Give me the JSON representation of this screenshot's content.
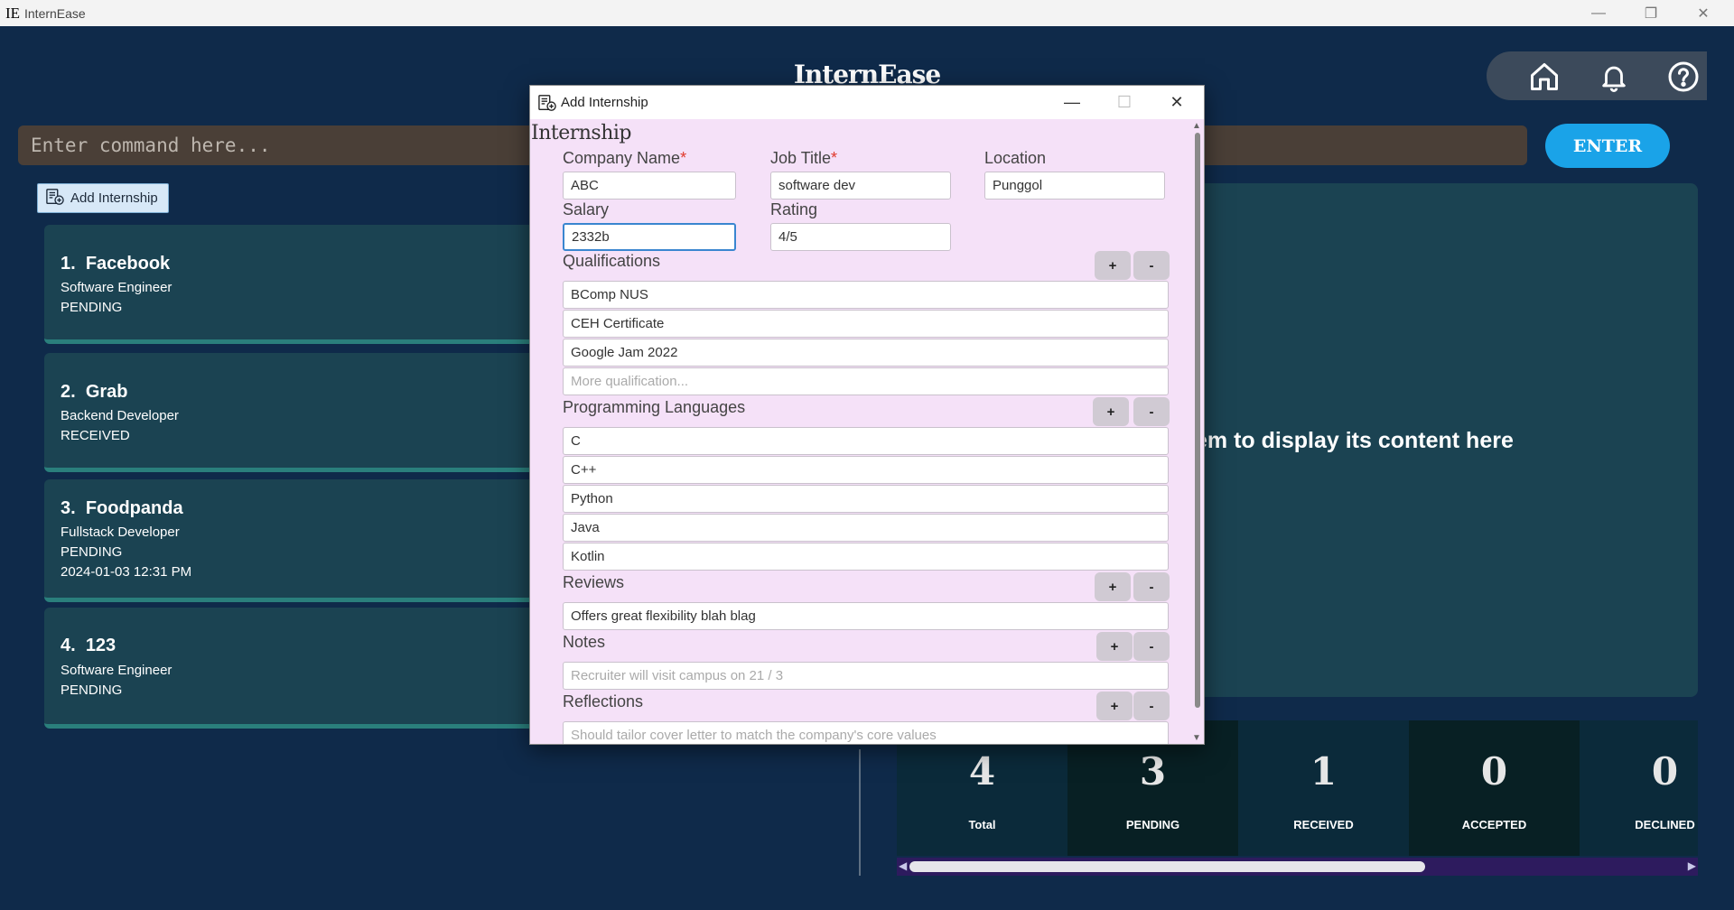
{
  "window": {
    "logo": "IE",
    "title": "InternEase",
    "minimize": "—",
    "maximize": "❐",
    "close": "✕"
  },
  "header": {
    "title": "InternEase"
  },
  "command": {
    "placeholder": "Enter command here...",
    "enter_label": "ENTER"
  },
  "add_button": {
    "label": "Add Internship"
  },
  "internships": [
    {
      "index": "1.",
      "company": "Facebook",
      "role": "Software Engineer",
      "status": "PENDING",
      "date": ""
    },
    {
      "index": "2.",
      "company": "Grab",
      "role": "Backend Developer",
      "status": "RECEIVED",
      "date": ""
    },
    {
      "index": "3.",
      "company": "Foodpanda",
      "role": "Fullstack Developer",
      "status": "PENDING",
      "date": "2024-01-03 12:31 PM"
    },
    {
      "index": "4.",
      "company": "123",
      "role": "Software Engineer",
      "status": "PENDING",
      "date": ""
    }
  ],
  "display": {
    "message": "em to display its content here"
  },
  "stats": [
    {
      "value": "4",
      "label": "Total"
    },
    {
      "value": "3",
      "label": "PENDING"
    },
    {
      "value": "1",
      "label": "RECEIVED"
    },
    {
      "value": "0",
      "label": "ACCEPTED"
    },
    {
      "value": "0",
      "label": "DECLINED"
    }
  ],
  "dialog": {
    "title": "Add Internship",
    "form_title": "Internship",
    "company_name": {
      "label": "Company Name",
      "required": "*",
      "value": "ABC"
    },
    "job_title": {
      "label": "Job Title",
      "required": "*",
      "value": "software dev"
    },
    "location": {
      "label": "Location",
      "value": "Punggol"
    },
    "salary": {
      "label": "Salary",
      "value": "2332b"
    },
    "rating": {
      "label": "Rating",
      "value": "4/5"
    },
    "qualifications": {
      "label": "Qualifications",
      "items": [
        "BComp NUS",
        "CEH Certificate",
        "Google Jam 2022"
      ],
      "placeholder": "More qualification..."
    },
    "languages": {
      "label": "Programming Languages",
      "items": [
        "C",
        "C++",
        "Python",
        "Java",
        "Kotlin"
      ]
    },
    "reviews": {
      "label": "Reviews",
      "items": [
        "Offers great flexibility blah blag"
      ]
    },
    "notes": {
      "label": "Notes",
      "placeholder": "Recruiter will visit campus on 21 / 3"
    },
    "reflections": {
      "label": "Reflections",
      "placeholder": "Should tailor cover letter to match the company's core values"
    },
    "plus": "+",
    "minus": "-"
  }
}
